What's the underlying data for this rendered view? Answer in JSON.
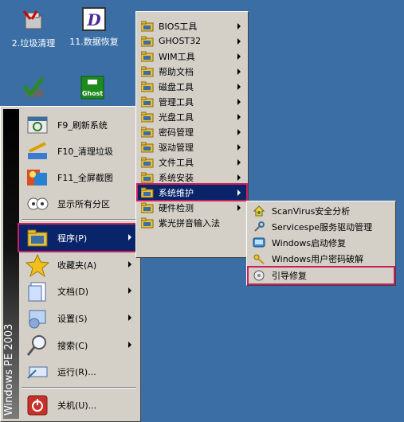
{
  "desktop": {
    "icons": [
      {
        "label": "2.垃圾清理",
        "icon": "trash-cleanup-icon"
      },
      {
        "label": "11.数据恢复",
        "icon": "data-recovery-icon"
      },
      {
        "label": "",
        "icon": "green-check-icon"
      },
      {
        "label": "",
        "icon": "ghost-icon",
        "glyph": "Ghost"
      }
    ]
  },
  "start_menu": {
    "banner": "Windows PE 2003",
    "items": [
      {
        "label": "F9_刷新系统",
        "icon": "refresh-system-icon"
      },
      {
        "label": "F10_清理垃圾",
        "icon": "clean-trash-icon"
      },
      {
        "label": "F11_全屏截图",
        "icon": "screenshot-icon"
      },
      {
        "label": "显示所有分区",
        "icon": "show-partitions-icon"
      },
      {
        "label": "程序(P)",
        "icon": "programs-icon",
        "selected": true,
        "submenu": true
      },
      {
        "label": "收藏夹(A)",
        "icon": "favorites-icon",
        "submenu": true
      },
      {
        "label": "文档(D)",
        "icon": "documents-icon",
        "submenu": true
      },
      {
        "label": "设置(S)",
        "icon": "settings-icon",
        "submenu": true
      },
      {
        "label": "搜索(C)",
        "icon": "search-icon",
        "submenu": true
      },
      {
        "label": "运行(R)...",
        "icon": "run-icon"
      },
      {
        "label": "关机(U)...",
        "icon": "shutdown-icon"
      }
    ]
  },
  "programs_menu": {
    "items": [
      {
        "label": "BIOS工具",
        "submenu": true
      },
      {
        "label": "GHOST32",
        "submenu": true
      },
      {
        "label": "WIM工具",
        "submenu": true
      },
      {
        "label": "帮助文档",
        "submenu": true
      },
      {
        "label": "磁盘工具",
        "submenu": true
      },
      {
        "label": "管理工具",
        "submenu": true
      },
      {
        "label": "光盘工具",
        "submenu": true
      },
      {
        "label": "密码管理",
        "submenu": true
      },
      {
        "label": "驱动管理",
        "submenu": true
      },
      {
        "label": "文件工具",
        "submenu": true
      },
      {
        "label": "系统安装",
        "submenu": true
      },
      {
        "label": "系统维护",
        "submenu": true,
        "selected": true
      },
      {
        "label": "硬件检测",
        "submenu": true
      },
      {
        "label": "紫光拼音输入法",
        "submenu": false
      }
    ]
  },
  "system_maintenance_menu": {
    "items": [
      {
        "label": "ScanVirus安全分析",
        "icon": "scanvirus-icon"
      },
      {
        "label": "Servicespe服务驱动管理",
        "icon": "services-icon"
      },
      {
        "label": "Windows启动修复",
        "icon": "windows-boot-icon"
      },
      {
        "label": "Windows用户密码破解",
        "icon": "key-icon"
      },
      {
        "label": "引导修复",
        "icon": "boot-repair-icon",
        "highlighted": true
      }
    ]
  },
  "colors": {
    "desktop": "#3a6ea5",
    "menu": "#d4d0c8",
    "selection": "#0a246a",
    "highlight_border": "#cc1f5e"
  }
}
